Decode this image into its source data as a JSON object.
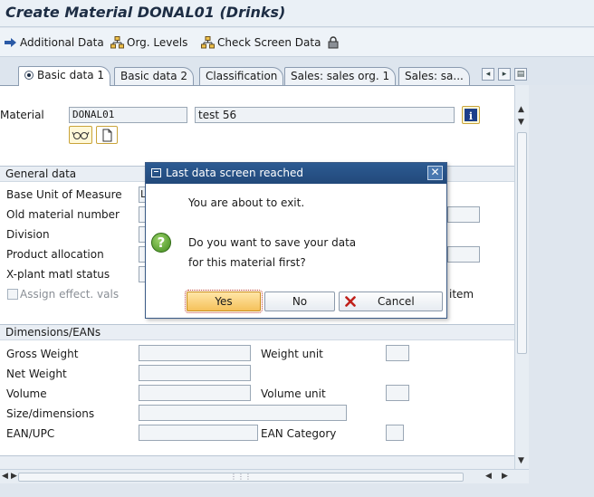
{
  "window": {
    "title": "Create Material DONAL01 (Drinks)"
  },
  "toolbar": {
    "additional_data": "Additional Data",
    "org_levels": "Org. Levels",
    "check_screen_data": "Check Screen Data"
  },
  "tabs": [
    {
      "label": "Basic data 1",
      "active": true
    },
    {
      "label": "Basic data 2"
    },
    {
      "label": "Classification"
    },
    {
      "label": "Sales: sales org. 1"
    },
    {
      "label": "Sales: sa..."
    }
  ],
  "material": {
    "label": "Material",
    "value": "DONAL01",
    "description": "test 56"
  },
  "general_data": {
    "header": "General data",
    "labels": {
      "base_uom": "Base Unit of Measure",
      "old_material": "Old material number",
      "division": "Division",
      "product_allocation": "Product allocation",
      "xplant_status": "X-plant matl status",
      "assign_effect": "Assign effect. vals"
    },
    "base_uom_value": "L",
    "right_partial_label": "item"
  },
  "dimensions": {
    "header": "Dimensions/EANs",
    "labels": {
      "gross_weight": "Gross Weight",
      "weight_unit": "Weight unit",
      "net_weight": "Net Weight",
      "volume": "Volume",
      "volume_unit": "Volume unit",
      "size_dimensions": "Size/dimensions",
      "ean_upc": "EAN/UPC",
      "ean_category": "EAN Category"
    }
  },
  "dialog": {
    "title": "Last data screen reached",
    "line1": "You are about to exit.",
    "line2": "Do you want to save your data",
    "line3": "for this material first?",
    "yes": "Yes",
    "no": "No",
    "cancel": "Cancel"
  },
  "colors": {
    "sap_blue": "#22497a",
    "tab_bg": "#eef2f7",
    "highlight": "#f5c15a"
  }
}
